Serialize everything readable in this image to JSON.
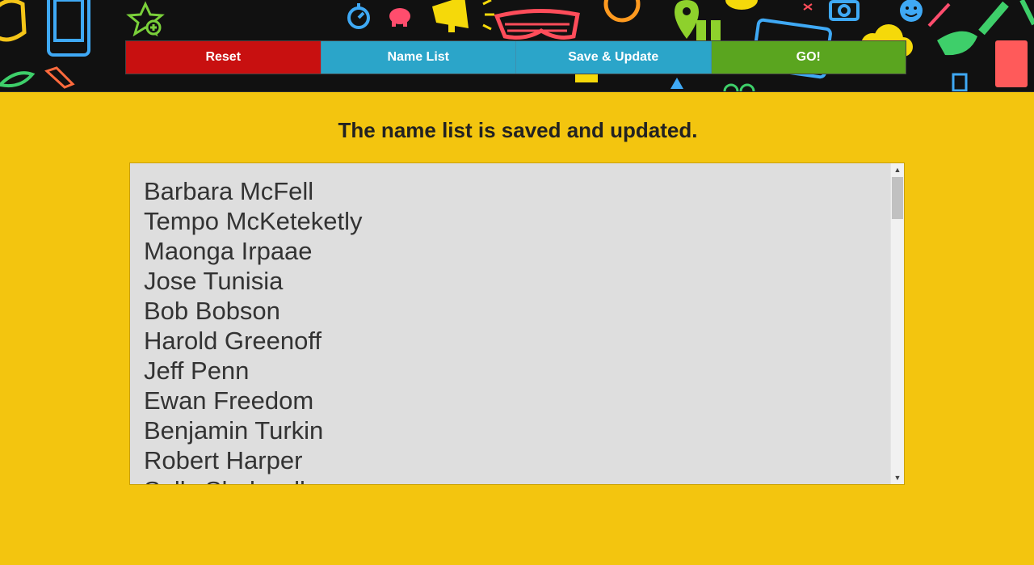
{
  "toolbar": {
    "reset_label": "Reset",
    "namelist_label": "Name List",
    "save_label": "Save & Update",
    "go_label": "GO!"
  },
  "main": {
    "status_message": "The name list is saved and updated.",
    "names": [
      "Barbara McFell",
      "Tempo McKeteketly",
      "Maonga Irpaae",
      "Jose Tunisia",
      "Bob Bobson",
      "Harold Greenoff",
      "Jeff Penn",
      "Ewan Freedom",
      "Benjamin Turkin",
      "Robert Harper",
      "Sally Shakwell"
    ]
  },
  "colors": {
    "page_background": "#f3c50f",
    "header_background": "#111111",
    "reset": "#c81010",
    "namelist": "#2ba5c9",
    "save": "#2ba5c9",
    "go": "#5aa51f",
    "textarea_background": "#dedede"
  },
  "icons": {
    "header_doodles": [
      "phone-icon",
      "smartphone-icon",
      "star-plus-icon",
      "stopwatch-icon",
      "piggy-bank-icon",
      "megaphone-icon",
      "shutter-glasses-icon",
      "clock-icon",
      "map-pin-icon",
      "camera-icon",
      "smiley-icon",
      "pen-icon",
      "book-icon",
      "leaf-icon",
      "pencil-icon",
      "card-icon",
      "cloud-icon"
    ],
    "scroll_up": "scroll-up-arrow-icon",
    "scroll_down": "scroll-down-arrow-icon"
  }
}
